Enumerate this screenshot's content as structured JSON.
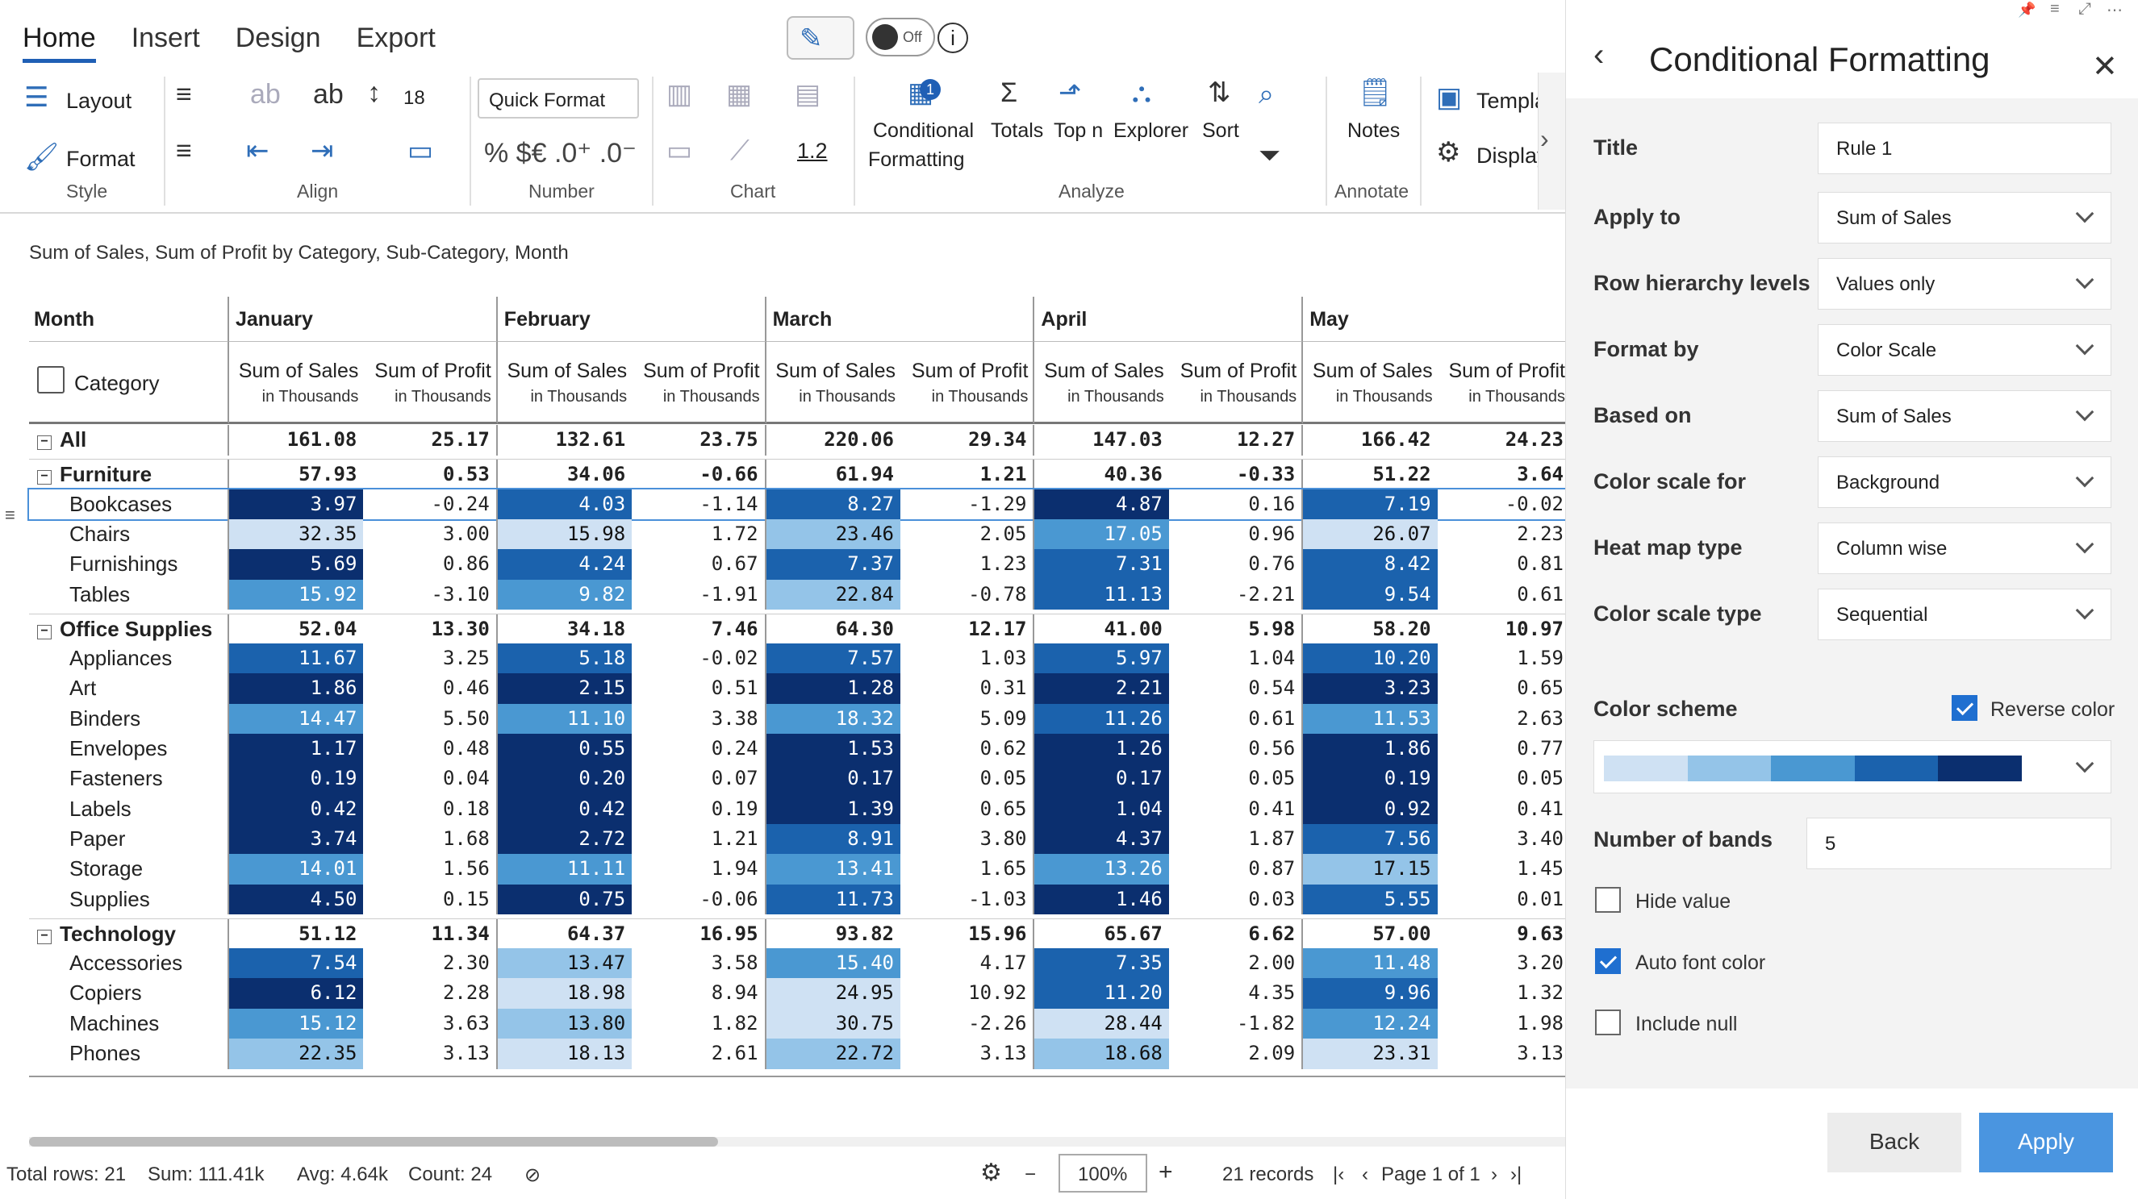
{
  "ribbon": {
    "tabs": [
      "Home",
      "Insert",
      "Design",
      "Export"
    ],
    "toggle_label": "Off",
    "layout_label": "Layout",
    "format_label": "Format",
    "font_size": "18",
    "quick_format": "Quick Format",
    "number_glyphs": "% $€ .0⁺ .0⁻",
    "chart_value": "1.2",
    "conditional_label_1": "Conditional",
    "conditional_label_2": "Formatting",
    "conditional_badge": "1",
    "totals": "Totals",
    "topn": "Top n",
    "explorer": "Explorer",
    "sort": "Sort",
    "notes": "Notes",
    "templates": "Templa",
    "display": "Display",
    "groups": [
      "Style",
      "Align",
      "Number",
      "Chart",
      "Analyze",
      "Annotate"
    ]
  },
  "table": {
    "subtitle": "Sum of Sales, Sum of Profit by Category, Sub-Category, Month",
    "month_header": "Month",
    "category_header": "Category",
    "months": [
      "January",
      "February",
      "March",
      "April",
      "May"
    ],
    "measure_a": "Sum of Sales",
    "measure_b": "Sum of Profit",
    "measure_sub": "in Thousands",
    "rows": [
      {
        "label": "All",
        "level": 0,
        "bold": true,
        "values": [
          "161.08",
          "25.17",
          "132.61",
          "23.75",
          "220.06",
          "29.34",
          "147.03",
          "12.27",
          "166.42",
          "24.23"
        ]
      },
      {
        "label": "Furniture",
        "level": 0,
        "bold": true,
        "values": [
          "57.93",
          "0.53",
          "34.06",
          "-0.66",
          "61.94",
          "1.21",
          "40.36",
          "-0.33",
          "51.22",
          "3.64"
        ]
      },
      {
        "label": "Bookcases",
        "level": 1,
        "values": [
          "3.97",
          "-0.24",
          "4.03",
          "-1.14",
          "8.27",
          "-1.29",
          "4.87",
          "0.16",
          "7.19",
          "-0.02"
        ]
      },
      {
        "label": "Chairs",
        "level": 1,
        "values": [
          "32.35",
          "3.00",
          "15.98",
          "1.72",
          "23.46",
          "2.05",
          "17.05",
          "0.96",
          "26.07",
          "2.23"
        ]
      },
      {
        "label": "Furnishings",
        "level": 1,
        "values": [
          "5.69",
          "0.86",
          "4.24",
          "0.67",
          "7.37",
          "1.23",
          "7.31",
          "0.76",
          "8.42",
          "0.81"
        ]
      },
      {
        "label": "Tables",
        "level": 1,
        "values": [
          "15.92",
          "-3.10",
          "9.82",
          "-1.91",
          "22.84",
          "-0.78",
          "11.13",
          "-2.21",
          "9.54",
          "0.61"
        ]
      },
      {
        "label": "Office Supplies",
        "level": 0,
        "bold": true,
        "values": [
          "52.04",
          "13.30",
          "34.18",
          "7.46",
          "64.30",
          "12.17",
          "41.00",
          "5.98",
          "58.20",
          "10.97"
        ]
      },
      {
        "label": "Appliances",
        "level": 1,
        "values": [
          "11.67",
          "3.25",
          "5.18",
          "-0.02",
          "7.57",
          "1.03",
          "5.97",
          "1.04",
          "10.20",
          "1.59"
        ]
      },
      {
        "label": "Art",
        "level": 1,
        "values": [
          "1.86",
          "0.46",
          "2.15",
          "0.51",
          "1.28",
          "0.31",
          "2.21",
          "0.54",
          "3.23",
          "0.65"
        ]
      },
      {
        "label": "Binders",
        "level": 1,
        "values": [
          "14.47",
          "5.50",
          "11.10",
          "3.38",
          "18.32",
          "5.09",
          "11.26",
          "0.61",
          "11.53",
          "2.63"
        ]
      },
      {
        "label": "Envelopes",
        "level": 1,
        "values": [
          "1.17",
          "0.48",
          "0.55",
          "0.24",
          "1.53",
          "0.62",
          "1.26",
          "0.56",
          "1.86",
          "0.77"
        ]
      },
      {
        "label": "Fasteners",
        "level": 1,
        "values": [
          "0.19",
          "0.04",
          "0.20",
          "0.07",
          "0.17",
          "0.05",
          "0.17",
          "0.05",
          "0.19",
          "0.05"
        ]
      },
      {
        "label": "Labels",
        "level": 1,
        "values": [
          "0.42",
          "0.18",
          "0.42",
          "0.19",
          "1.39",
          "0.65",
          "1.04",
          "0.41",
          "0.92",
          "0.41"
        ]
      },
      {
        "label": "Paper",
        "level": 1,
        "values": [
          "3.74",
          "1.68",
          "2.72",
          "1.21",
          "8.91",
          "3.80",
          "4.37",
          "1.87",
          "7.56",
          "3.40"
        ]
      },
      {
        "label": "Storage",
        "level": 1,
        "values": [
          "14.01",
          "1.56",
          "11.11",
          "1.94",
          "13.41",
          "1.65",
          "13.26",
          "0.87",
          "17.15",
          "1.45"
        ]
      },
      {
        "label": "Supplies",
        "level": 1,
        "values": [
          "4.50",
          "0.15",
          "0.75",
          "-0.06",
          "11.73",
          "-1.03",
          "1.46",
          "0.03",
          "5.55",
          "0.01"
        ]
      },
      {
        "label": "Technology",
        "level": 0,
        "bold": true,
        "values": [
          "51.12",
          "11.34",
          "64.37",
          "16.95",
          "93.82",
          "15.96",
          "65.67",
          "6.62",
          "57.00",
          "9.63"
        ]
      },
      {
        "label": "Accessories",
        "level": 1,
        "values": [
          "7.54",
          "2.30",
          "13.47",
          "3.58",
          "15.40",
          "4.17",
          "7.35",
          "2.00",
          "11.48",
          "3.20"
        ]
      },
      {
        "label": "Copiers",
        "level": 1,
        "values": [
          "6.12",
          "2.28",
          "18.98",
          "8.94",
          "24.95",
          "10.92",
          "11.20",
          "4.35",
          "9.96",
          "1.32"
        ]
      },
      {
        "label": "Machines",
        "level": 1,
        "values": [
          "15.12",
          "3.63",
          "13.80",
          "1.82",
          "30.75",
          "-2.26",
          "28.44",
          "-1.82",
          "12.24",
          "1.98"
        ]
      },
      {
        "label": "Phones",
        "level": 1,
        "values": [
          "22.35",
          "3.13",
          "18.13",
          "2.61",
          "22.72",
          "3.13",
          "18.68",
          "2.09",
          "23.31",
          "3.13"
        ]
      }
    ]
  },
  "status": {
    "total_rows": "Total rows: 21",
    "sum": "Sum: 111.41k",
    "avg": "Avg: 4.64k",
    "count": "Count: 24",
    "zoom": "100%",
    "records": "21 records",
    "page": "Page 1 of 1"
  },
  "panel": {
    "title": "Conditional Formatting",
    "fields": [
      {
        "label": "Title",
        "value": "Rule 1",
        "dropdown": false
      },
      {
        "label": "Apply to",
        "value": "Sum of Sales",
        "dropdown": true
      },
      {
        "label": "Row hierarchy levels",
        "value": "Values only",
        "dropdown": true
      },
      {
        "label": "Format by",
        "value": "Color Scale",
        "dropdown": true
      },
      {
        "label": "Based on",
        "value": "Sum of Sales",
        "dropdown": true
      },
      {
        "label": "Color scale for",
        "value": "Background",
        "dropdown": true
      },
      {
        "label": "Heat map type",
        "value": "Column wise",
        "dropdown": true
      },
      {
        "label": "Color scale type",
        "value": "Sequential",
        "dropdown": true
      }
    ],
    "color_scheme_label": "Color scheme",
    "reverse_color": "Reverse color",
    "scheme_colors": [
      "#cfe1f3",
      "#94c4e8",
      "#4a98d2",
      "#1b62ad",
      "#0b2f6f"
    ],
    "bands_label": "Number of bands",
    "bands_value": "5",
    "hide_value": "Hide value",
    "auto_font_color": "Auto font color",
    "include_null": "Include null",
    "back": "Back",
    "apply": "Apply"
  }
}
